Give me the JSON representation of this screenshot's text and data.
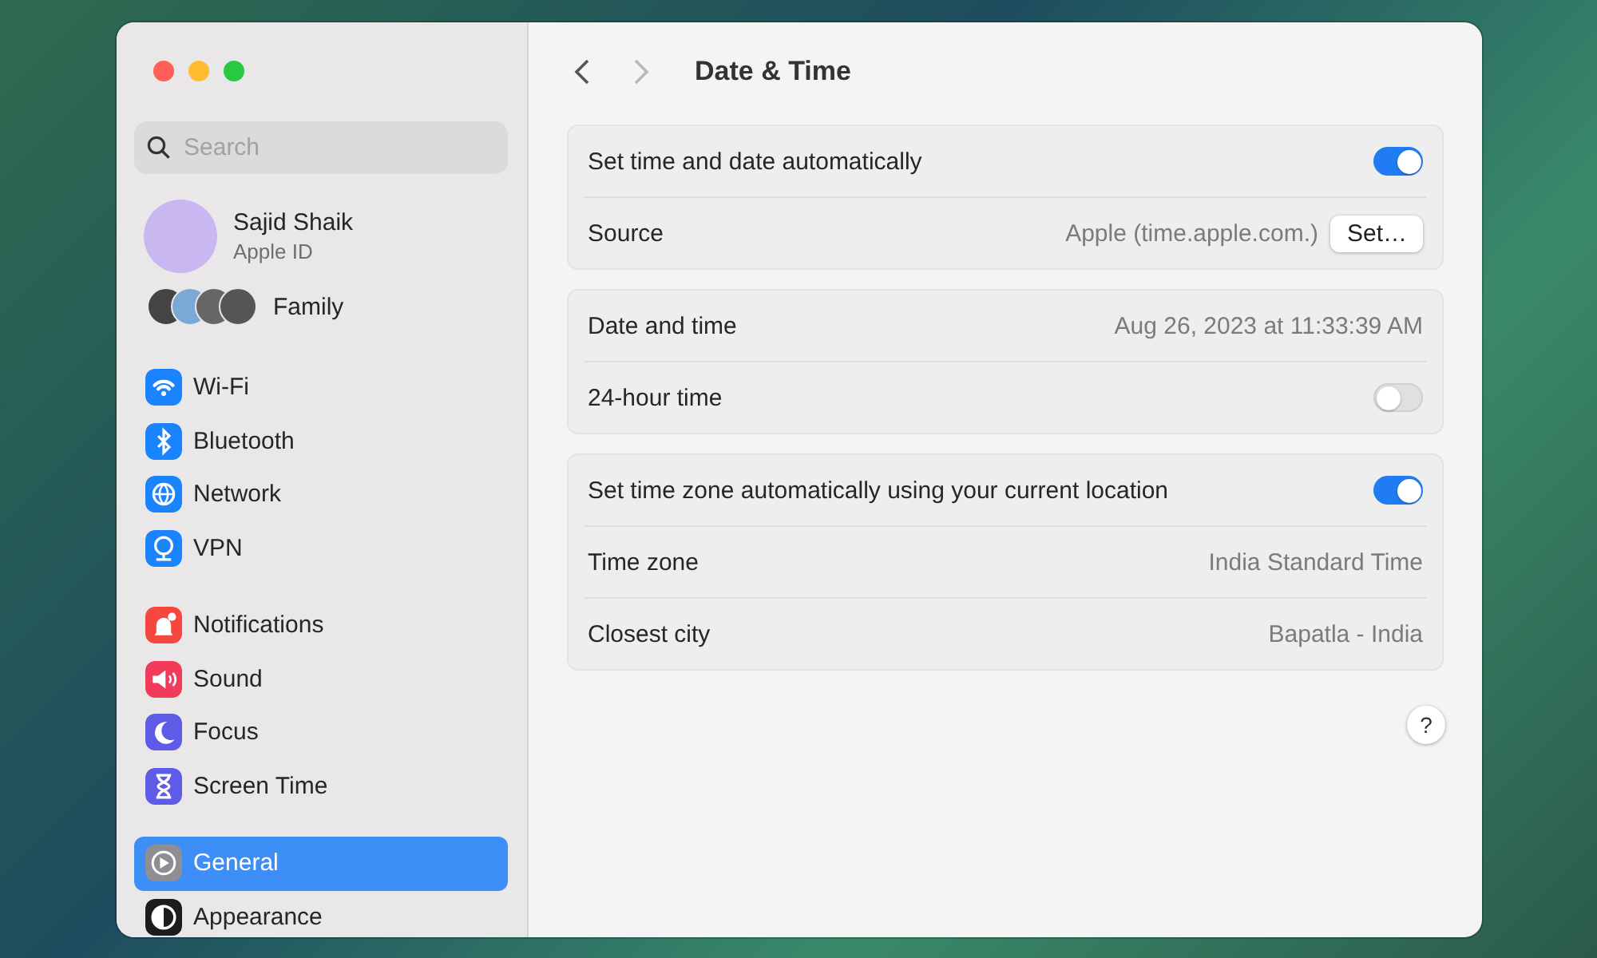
{
  "window": {
    "title": "Date & Time"
  },
  "sidebar": {
    "search": {
      "placeholder": "Search"
    },
    "account": {
      "name": "Sajid Shaik",
      "subtitle": "Apple ID"
    },
    "family": {
      "label": "Family"
    },
    "groups": [
      [
        {
          "label": "Wi-Fi",
          "color": "#1a84ff",
          "selected": false
        },
        {
          "label": "Bluetooth",
          "color": "#1a84ff",
          "selected": false
        },
        {
          "label": "Network",
          "color": "#1a84ff",
          "selected": false
        },
        {
          "label": "VPN",
          "color": "#1a84ff",
          "selected": false
        }
      ],
      [
        {
          "label": "Notifications",
          "color": "#f5463f",
          "selected": false
        },
        {
          "label": "Sound",
          "color": "#f23a5b",
          "selected": false
        },
        {
          "label": "Focus",
          "color": "#5e5ce6",
          "selected": false
        },
        {
          "label": "Screen Time",
          "color": "#5e5ce6",
          "selected": false
        }
      ],
      [
        {
          "label": "General",
          "color": "#8e8e93",
          "selected": true
        },
        {
          "label": "Appearance",
          "color": "#1c1c1e",
          "selected": false
        }
      ]
    ]
  },
  "toolbar": {
    "back_enabled": true,
    "forward_enabled": false
  },
  "sections": [
    [
      {
        "kind": "toggle",
        "label": "Set time and date automatically",
        "on": true
      },
      {
        "kind": "value",
        "label": "Source",
        "value": "Apple (time.apple.com.)",
        "button": "Set…"
      }
    ],
    [
      {
        "kind": "value",
        "label": "Date and time",
        "value": "Aug 26, 2023 at 11:33:39 AM"
      },
      {
        "kind": "toggle",
        "label": "24-hour time",
        "on": false
      }
    ],
    [
      {
        "kind": "toggle",
        "label": "Set time zone automatically using your current location",
        "on": true
      },
      {
        "kind": "value",
        "label": "Time zone",
        "value": "India Standard Time"
      },
      {
        "kind": "value",
        "label": "Closest city",
        "value": "Bapatla - India"
      }
    ]
  ],
  "help_button": "?"
}
